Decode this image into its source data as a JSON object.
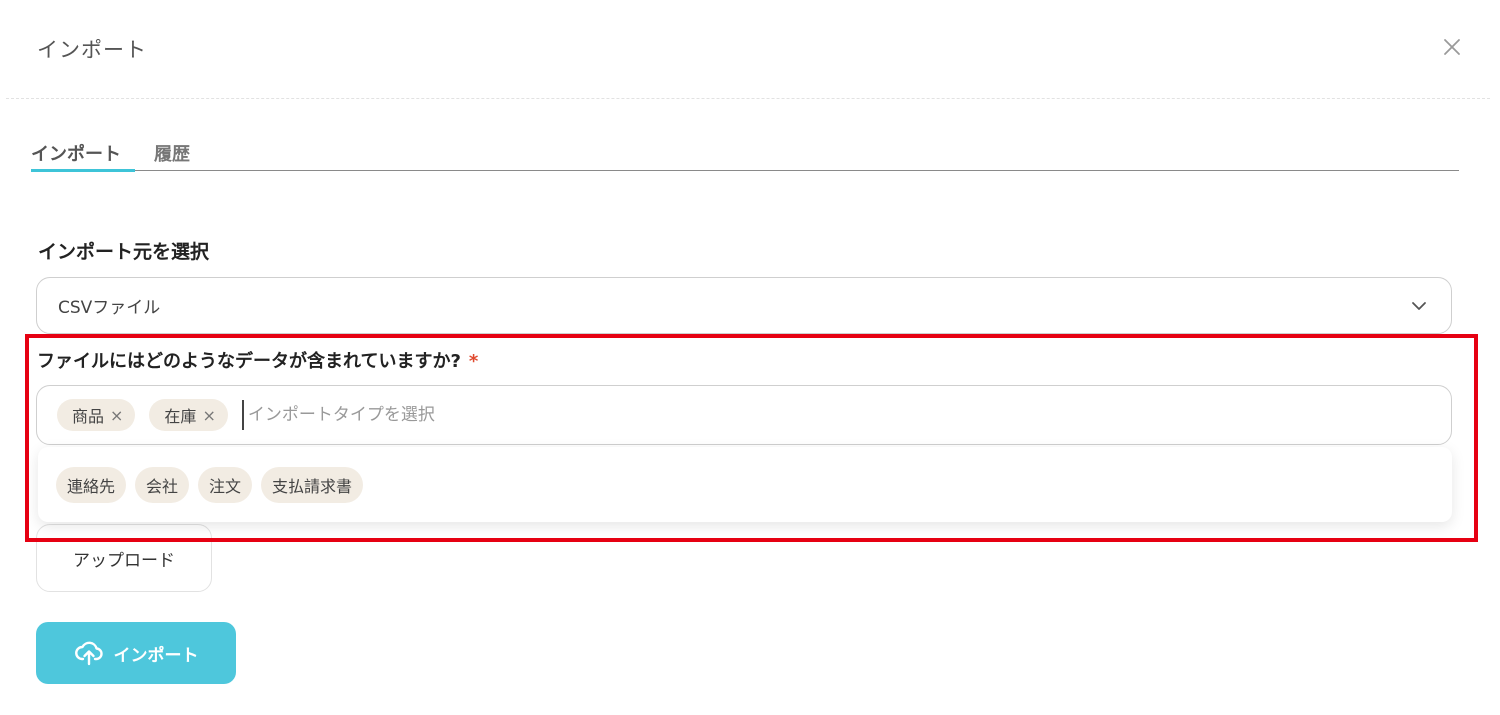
{
  "modal": {
    "title": "インポート",
    "close_icon": "close-icon"
  },
  "tabs": [
    {
      "label": "インポート",
      "active": true
    },
    {
      "label": "履歴",
      "active": false
    }
  ],
  "source": {
    "label": "インポート元を選択",
    "selected": "CSVファイル",
    "icon": "chevron-down-icon"
  },
  "data_types": {
    "question": "ファイルにはどのようなデータが含まれていますか?",
    "required_mark": "*",
    "selected": [
      "商品",
      "在庫"
    ],
    "remove_glyph": "×",
    "placeholder": "インポートタイプを選択",
    "options": [
      "連絡先",
      "会社",
      "注文",
      "支払請求書"
    ]
  },
  "upload": {
    "label": "アップロード"
  },
  "import_button": {
    "label": "インポート",
    "icon": "cloud-upload-icon"
  },
  "colors": {
    "accent": "#4ec7dc",
    "tab_underline": "#3ec4d8",
    "highlight_border": "#e60012",
    "chip_bg": "#f2ece3",
    "required": "#e04a2f"
  }
}
